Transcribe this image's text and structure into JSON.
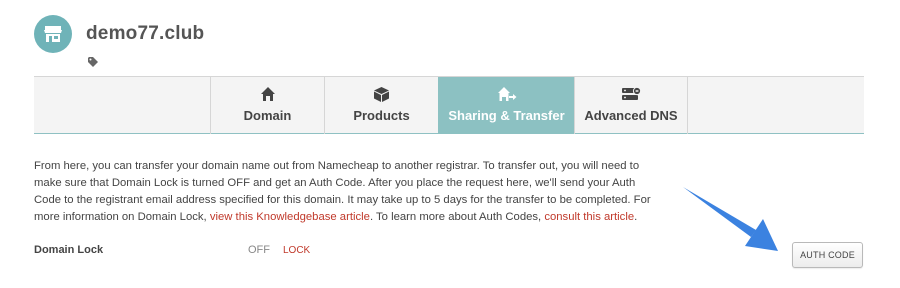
{
  "domain": {
    "name": "demo77.club"
  },
  "icons": {
    "avatar": "store-icon",
    "tag": "tag-icon"
  },
  "tabs": [
    {
      "label": "Domain",
      "icon": "home-icon",
      "active": false
    },
    {
      "label": "Products",
      "icon": "box-icon",
      "active": false
    },
    {
      "label": "Sharing & Transfer",
      "icon": "home-share-icon",
      "active": true
    },
    {
      "label": "Advanced DNS",
      "icon": "server-icon",
      "active": false
    }
  ],
  "description": {
    "part1": "From here, you can transfer your domain name out from Namecheap to another registrar. To transfer out, you will need to make sure that Domain Lock is turned OFF and get an Auth Code. After you place the request here, we'll send your Auth Code to the registrant email address specified for this domain. It may take up to 5 days for the transfer to be completed. For more information on Domain Lock, ",
    "link1": "view this Knowledgebase article",
    "part2": ". To learn more about Auth Codes, ",
    "link2": "consult this article",
    "part3": "."
  },
  "domain_lock": {
    "label": "Domain Lock",
    "status": "OFF",
    "action": "LOCK"
  },
  "auth_code_button": "AUTH CODE",
  "colors": {
    "accent": "#8cc1c2",
    "link": "#c0392b",
    "arrow": "#3b82e0"
  }
}
